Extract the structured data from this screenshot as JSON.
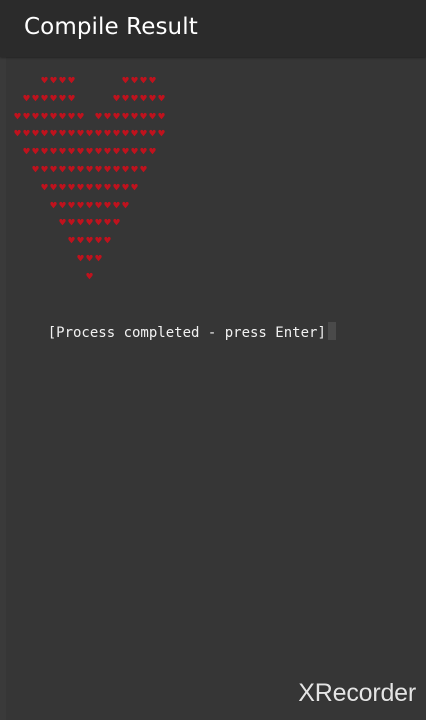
{
  "app": {
    "title": "Compile Result"
  },
  "console": {
    "heart_glyph": "♥",
    "heart_color": "#c0121d",
    "heart_pattern": [
      "   ####     ####",
      " ######    ######",
      "######## ########",
      "#################",
      " ###############",
      "  #############",
      "   ###########",
      "    #########",
      "     #######",
      "      #####",
      "       ###",
      "        #"
    ],
    "process_text": "[Process completed - press Enter]"
  },
  "watermark": {
    "text": "XRecorder"
  }
}
